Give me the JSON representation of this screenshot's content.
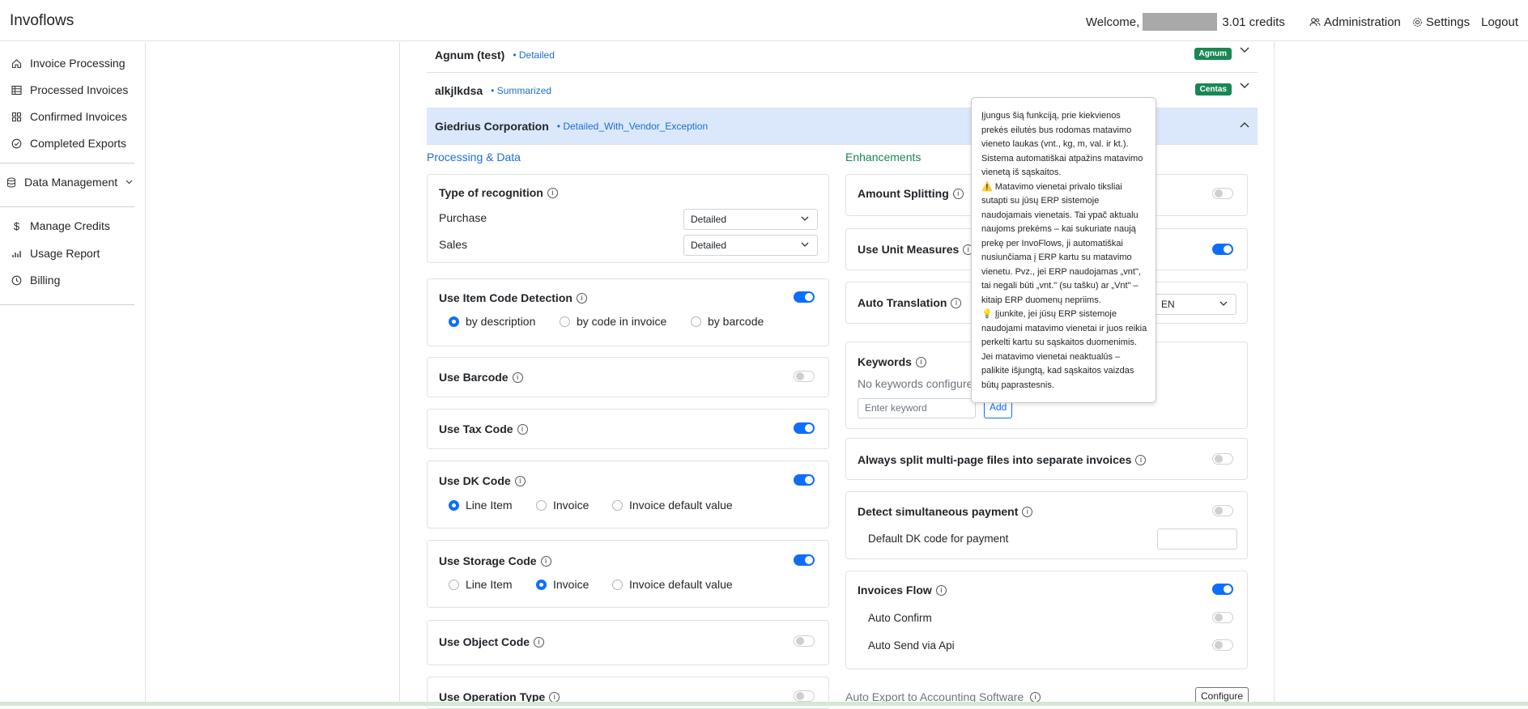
{
  "navbar": {
    "brand": "Invoflows",
    "welcome": "Welcome,",
    "credits": "3.01 credits",
    "administration": "Administration",
    "settings": "Settings",
    "logout": "Logout"
  },
  "sidebar": {
    "items": [
      {
        "label": "Invoice Processing",
        "icon": "home-icon"
      },
      {
        "label": "Processed Invoices",
        "icon": "table-icon"
      },
      {
        "label": "Confirmed Invoices",
        "icon": "grid-icon"
      },
      {
        "label": "Completed Exports",
        "icon": "check-circle-icon"
      },
      {
        "label": "Data Management",
        "icon": "database-icon"
      },
      {
        "label": "Manage Credits",
        "icon": "dollar-icon"
      },
      {
        "label": "Usage Report",
        "icon": "bar-chart-icon"
      },
      {
        "label": "Billing",
        "icon": "clock-icon"
      }
    ]
  },
  "companies": [
    {
      "name": "Agnum (test)",
      "mode": "• Detailed",
      "badge": "Agnum"
    },
    {
      "name": "alkjlkdsa",
      "mode": "• Summarized",
      "badge": "Centas"
    },
    {
      "name": "Giedrius Corporation",
      "mode": "• Detailed_With_Vendor_Exception",
      "badge": ""
    }
  ],
  "left": {
    "section_title": "Processing & Data",
    "recognition": {
      "title": "Type of recognition",
      "purchase_label": "Purchase",
      "purchase_value": "Detailed",
      "sales_label": "Sales",
      "sales_value": "Detailed"
    },
    "item_code": {
      "title": "Use Item Code Detection",
      "enabled": true,
      "options": [
        "by description",
        "by code in invoice",
        "by barcode"
      ],
      "selected": "by description"
    },
    "barcode": {
      "title": "Use Barcode",
      "enabled": false
    },
    "tax_code": {
      "title": "Use Tax Code",
      "enabled": true
    },
    "dk_code": {
      "title": "Use DK Code",
      "enabled": true,
      "options": [
        "Line Item",
        "Invoice",
        "Invoice default value"
      ],
      "selected": "Line Item"
    },
    "storage_code": {
      "title": "Use Storage Code",
      "enabled": true,
      "options": [
        "Line Item",
        "Invoice",
        "Invoice default value"
      ],
      "selected": "Invoice"
    },
    "object_code": {
      "title": "Use Object Code",
      "enabled": false
    },
    "operation_type": {
      "title": "Use Operation Type",
      "enabled": false
    }
  },
  "right": {
    "section_title": "Enhancements",
    "amount_splitting": {
      "title": "Amount Splitting",
      "enabled": false
    },
    "unit_measures": {
      "title": "Use Unit Measures",
      "enabled": true
    },
    "auto_translation": {
      "title": "Auto Translation",
      "value": "EN"
    },
    "keywords": {
      "title": "Keywords",
      "empty_text": "No keywords configured",
      "placeholder": "Enter keyword",
      "add_label": "Add"
    },
    "split_pages": {
      "title": "Always split multi-page files into separate invoices",
      "enabled": false
    },
    "simultaneous_payment": {
      "title": "Detect simultaneous payment",
      "enabled": false,
      "default_dk_label": "Default DK code for payment",
      "default_dk_value": ""
    },
    "invoices_flow": {
      "title": "Invoices Flow",
      "enabled": true,
      "auto_confirm_label": "Auto Confirm",
      "auto_confirm": false,
      "auto_send_label": "Auto Send via Api",
      "auto_send": false
    },
    "auto_export": {
      "title": "Auto Export to Accounting Software",
      "configure_label": "Configure"
    }
  },
  "tooltip": {
    "p1": "Įjungus šią funkciją, prie kiekvienos prekės eilutės bus rodomas matavimo vieneto laukas (vnt., kg, m, val. ir kt.). Sistema automatiškai atpažins matavimo vienetą iš sąskaitos.",
    "p2": "⚠️ Matavimo vienetai privalo tiksliai sutapti su jūsų ERP sistemoje naudojamais vienetais. Tai ypač aktualu naujoms prekėms – kai sukuriate naują prekę per InvoFlows, ji automatiškai nusiunčiama į ERP kartu su matavimo vienetu. Pvz., jei ERP naudojamas „vnt\", tai negali būti „vnt.\" (su tašku) ar „Vnt\" – kitaip ERP duomenų nepriims.",
    "p3": "💡 Įjunkite, jei jūsų ERP sistemoje naudojami matavimo vienetai ir juos reikia perkelti kartu su sąskaitos duomenimis. Jei matavimo vienetai neaktualūs – palikite išjungtą, kad sąskaitos vaizdas būtų paprastesnis."
  },
  "colors": {
    "primary": "#0d6efd",
    "link": "#1a6ed8",
    "success": "#198754",
    "active_row": "#dbe8fc"
  }
}
